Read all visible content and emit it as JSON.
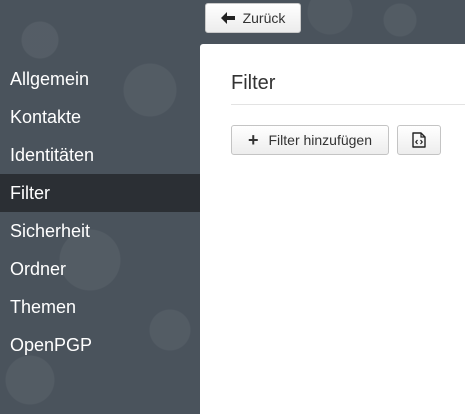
{
  "toolbar": {
    "back_label": "Zurück",
    "back_icon": "arrow-left-icon"
  },
  "sidebar": {
    "items": [
      {
        "label": "Allgemein",
        "active": false
      },
      {
        "label": "Kontakte",
        "active": false
      },
      {
        "label": "Identitäten",
        "active": false
      },
      {
        "label": "Filter",
        "active": true
      },
      {
        "label": "Sicherheit",
        "active": false
      },
      {
        "label": "Ordner",
        "active": false
      },
      {
        "label": "Themen",
        "active": false
      },
      {
        "label": "OpenPGP",
        "active": false
      }
    ]
  },
  "main": {
    "title": "Filter",
    "add_filter_label": "Filter hinzufügen",
    "add_filter_icon": "plus-icon",
    "script_icon": "code-file-icon"
  },
  "colors": {
    "background": "#4a535c",
    "sidebar_active": "#2b2f34",
    "panel": "#ffffff",
    "text_light": "#ffffff",
    "text_dark": "#333333"
  }
}
